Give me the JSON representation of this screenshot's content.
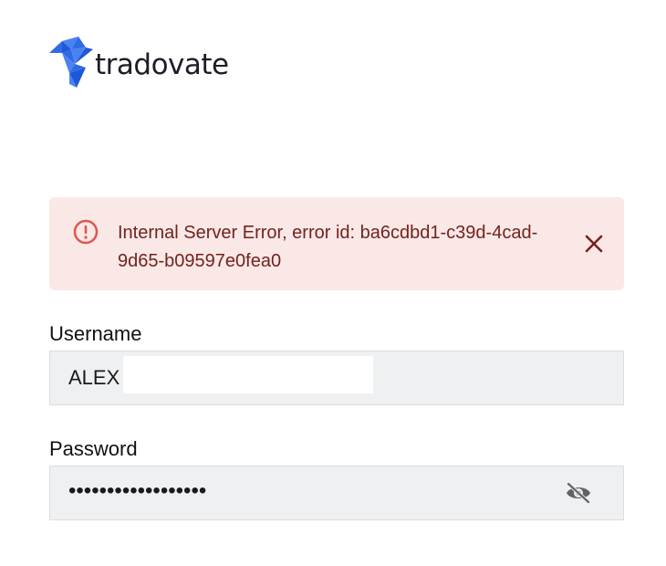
{
  "brand": {
    "name": "tradovate",
    "logo_color": "#2f6be8"
  },
  "alert": {
    "message": "Internal Server Error, error id: ba6cdbd1-c39d-4cad-9d65-b09597e0fea0",
    "icon": "error-circle-icon",
    "close_icon": "close-icon",
    "background": "#f9e8e6",
    "text_color": "#73221e",
    "icon_color": "#e0554d"
  },
  "form": {
    "username": {
      "label": "Username",
      "value": "ALEX"
    },
    "password": {
      "label": "Password",
      "masked_value": "••••••••••••••••••",
      "toggle_icon": "eye-off-icon"
    }
  }
}
